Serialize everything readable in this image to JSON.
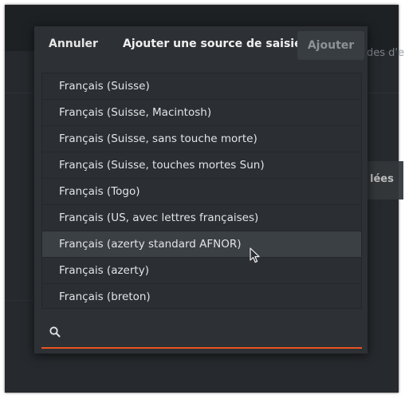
{
  "background": {
    "fragment_top": "des d'e",
    "fragment_button": "lées"
  },
  "dialog": {
    "cancel_label": "Annuler",
    "title": "Ajouter une source de saisie",
    "add_label": "Ajouter"
  },
  "list": {
    "items": [
      {
        "label": "Français (Suisse)"
      },
      {
        "label": "Français (Suisse, Macintosh)"
      },
      {
        "label": "Français (Suisse, sans touche morte)"
      },
      {
        "label": "Français (Suisse, touches mortes Sun)"
      },
      {
        "label": "Français (Togo)"
      },
      {
        "label": "Français (US, avec lettres françaises)"
      },
      {
        "label": "Français (azerty standard AFNOR)"
      },
      {
        "label": "Français (azerty)"
      },
      {
        "label": "Français (breton)"
      }
    ],
    "hovered_index": 6
  },
  "search": {
    "value": "",
    "placeholder": "",
    "icon": "search-icon"
  },
  "colors": {
    "accent": "#e95420",
    "dialog_bg": "#2d3135",
    "hover_row": "#3b4045"
  }
}
